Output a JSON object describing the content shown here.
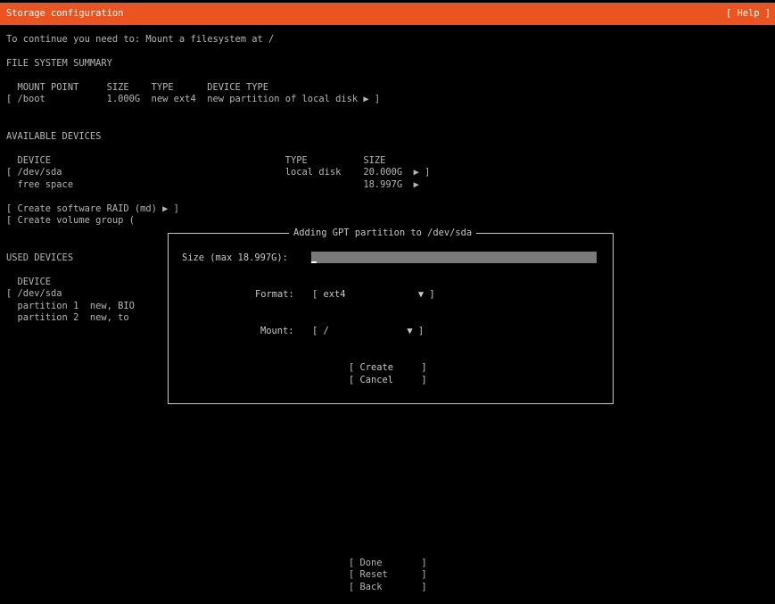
{
  "header": {
    "title": "Storage configuration",
    "help": "[ Help ]"
  },
  "instruction": "To continue you need to: Mount a filesystem at /",
  "fs_summary": {
    "heading": "FILE SYSTEM SUMMARY",
    "columns_line": "  MOUNT POINT     SIZE    TYPE      DEVICE TYPE",
    "rows": [
      "[ /boot           1.000G  new ext4  new partition of local disk ▶ ]"
    ]
  },
  "available": {
    "heading": "AVAILABLE DEVICES",
    "columns_line": "  DEVICE                                          TYPE          SIZE",
    "rows": [
      "[ /dev/sda                                        local disk    20.000G  ▶ ]",
      "  free space                                                    18.997G  ▶"
    ],
    "actions": [
      "[ Create software RAID (md) ▶ ]",
      "[ Create volume group ("
    ]
  },
  "used": {
    "heading": "USED DEVICES",
    "columns_line": "  DEVICE",
    "rows": [
      "[ /dev/sda",
      "  partition 1  new, BIO",
      "  partition 2  new, to"
    ]
  },
  "dialog": {
    "title": "Adding GPT partition to /dev/sda",
    "size_label": "Size (max 18.997G):",
    "size_value": "",
    "format_label": "Format:",
    "format_value": "[ ext4             ▼ ]",
    "mount_label": "Mount:",
    "mount_value": "[ /              ▼ ]",
    "create_button": "[ Create     ]",
    "cancel_button": "[ Cancel     ]"
  },
  "bottom_buttons": {
    "done": "[ Done       ]",
    "reset": "[ Reset      ]",
    "back": "[ Back       ]"
  },
  "colors": {
    "accent": "#e95420",
    "background": "#000000",
    "text": "#b6b6b6"
  }
}
